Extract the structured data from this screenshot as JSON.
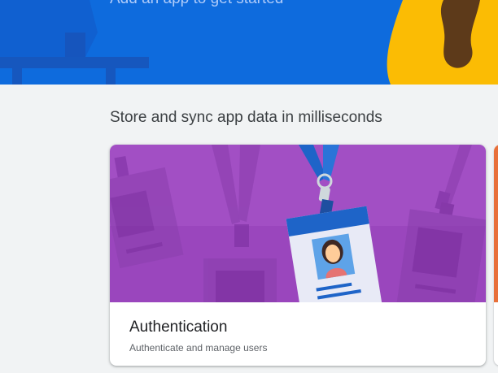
{
  "hero": {
    "subtitle": "Add an app to get started"
  },
  "section": {
    "title": "Store and sync app data in milliseconds"
  },
  "cards": [
    {
      "title": "Authentication",
      "description": "Authenticate and manage users",
      "illustration": "id-badge-illustration"
    }
  ],
  "colors": {
    "hero_bg": "#0e6bdd",
    "card_art_bg": "#a24fc4",
    "next_card_accent": "#e8703a",
    "page_bg": "#f1f3f4"
  }
}
